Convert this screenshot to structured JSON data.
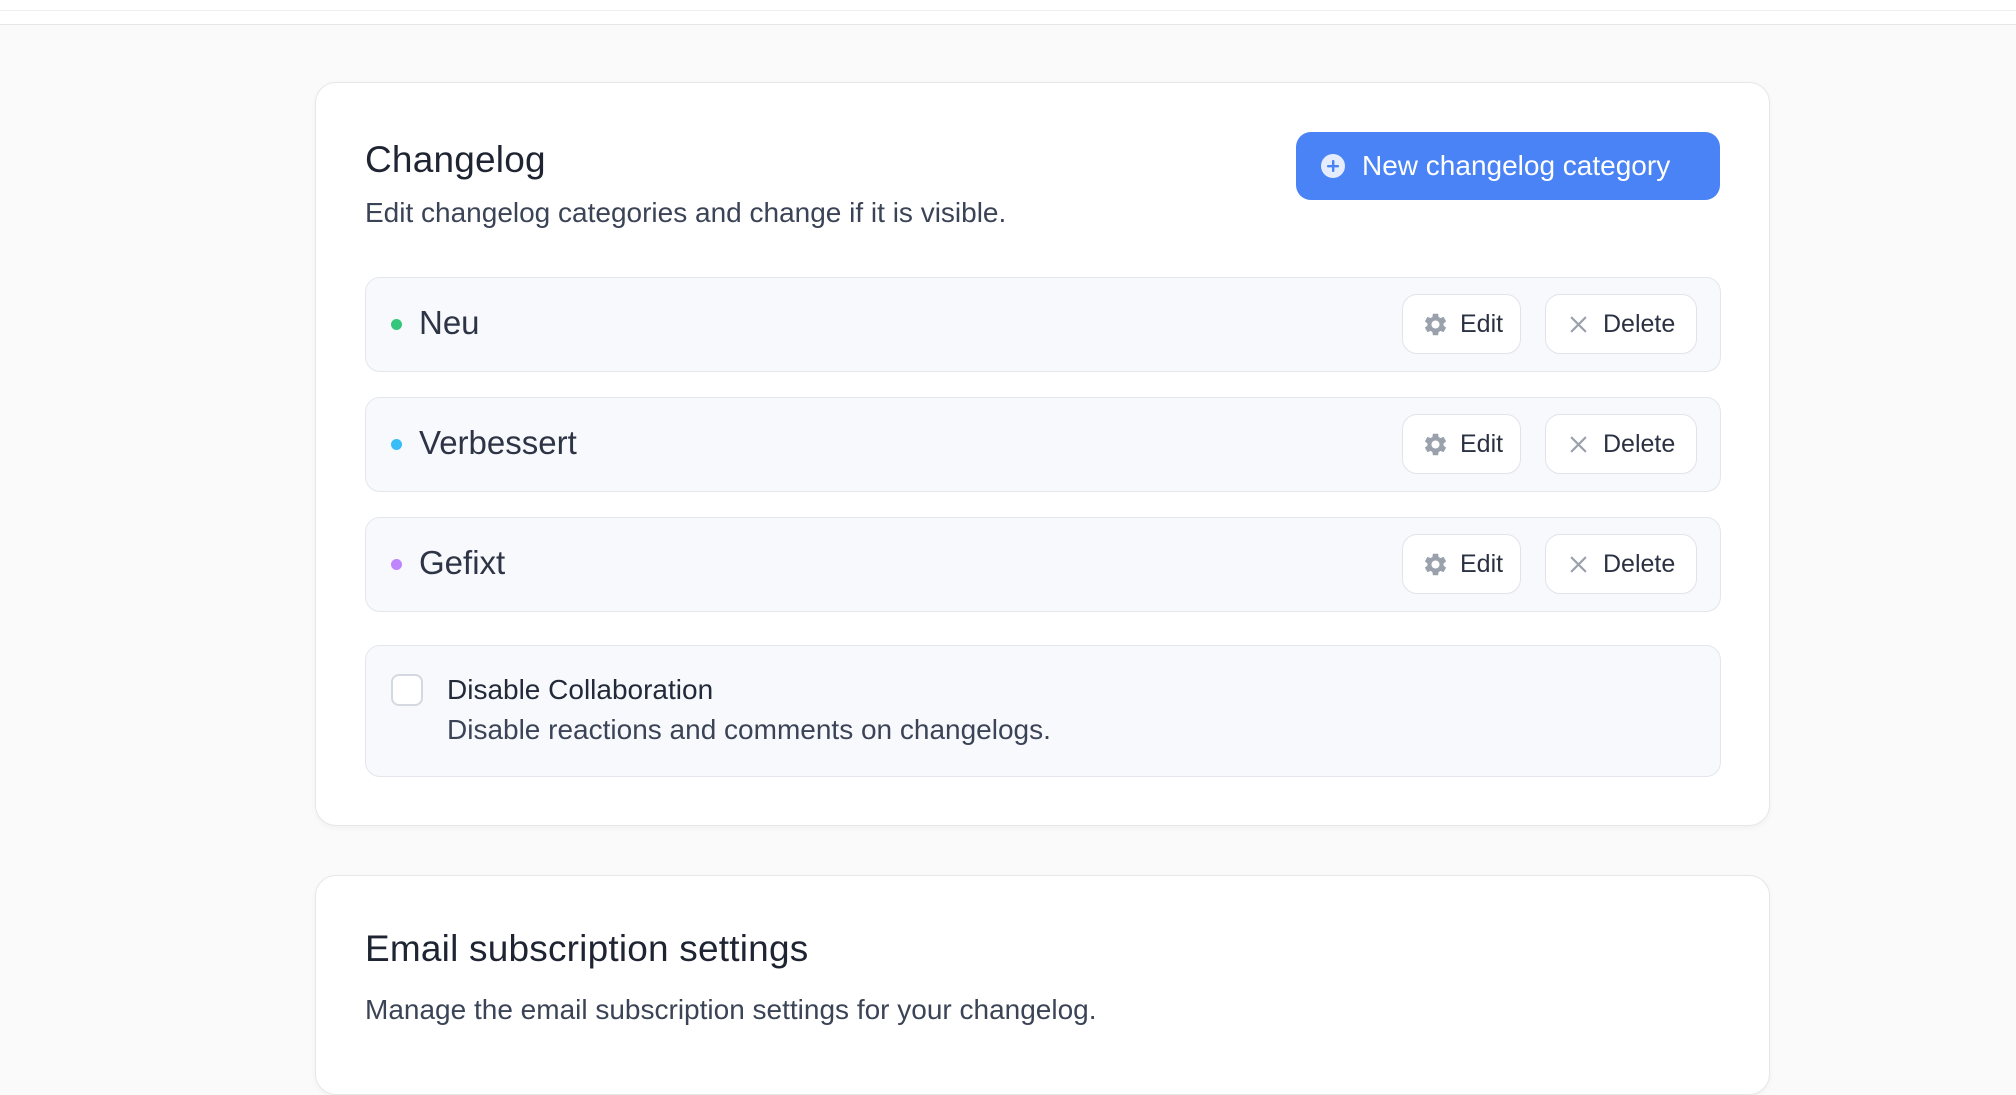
{
  "changelog": {
    "title": "Changelog",
    "description": "Edit changelog categories and change if it is visible.",
    "new_button_label": "New changelog category",
    "accent_color": "#4a83f5",
    "categories": [
      {
        "name": "Neu",
        "dot_color": "#34c77b",
        "edit_label": "Edit",
        "delete_label": "Delete"
      },
      {
        "name": "Verbessert",
        "dot_color": "#38bdf8",
        "edit_label": "Edit",
        "delete_label": "Delete"
      },
      {
        "name": "Gefixt",
        "dot_color": "#c084fc",
        "edit_label": "Edit",
        "delete_label": "Delete"
      }
    ],
    "collaboration": {
      "title": "Disable Collaboration",
      "description": "Disable reactions and comments on changelogs.",
      "checked": false
    }
  },
  "email_settings": {
    "title": "Email subscription settings",
    "description": "Manage the email subscription settings for your changelog."
  },
  "icons": {
    "new_button": "plus-circle-icon",
    "edit": "gear-icon",
    "delete": "close-icon"
  }
}
